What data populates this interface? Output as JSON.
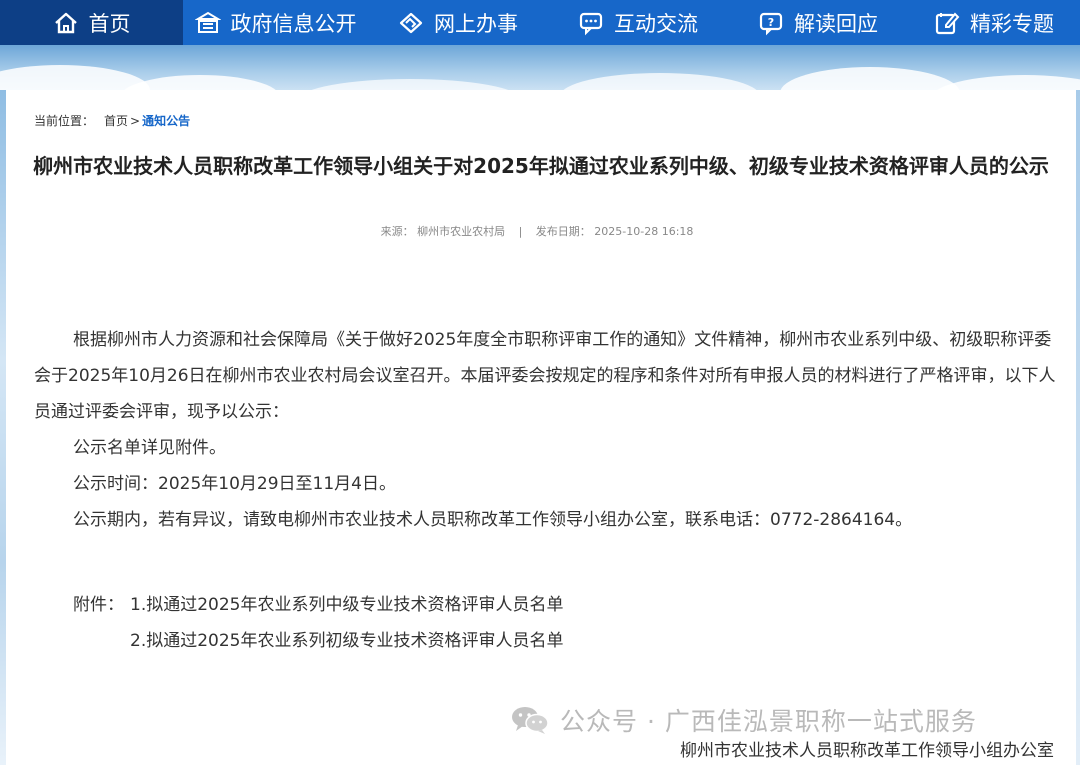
{
  "nav": {
    "items": [
      {
        "label": "首页",
        "icon": "home-icon"
      },
      {
        "label": "政府信息公开",
        "icon": "building-icon"
      },
      {
        "label": "网上办事",
        "icon": "handshake-icon"
      },
      {
        "label": "互动交流",
        "icon": "chat-icon"
      },
      {
        "label": "解读回应",
        "icon": "question-chat-icon"
      },
      {
        "label": "精彩专题",
        "icon": "edit-icon"
      }
    ]
  },
  "breadcrumb": {
    "prefix": "当前位置：",
    "home": "首页",
    "separator": ">",
    "current": "通知公告"
  },
  "article": {
    "title": "柳州市农业技术人员职称改革工作领导小组关于对2025年拟通过农业系列中级、初级专业技术资格评审人员的公示",
    "source_label": "来源：",
    "source": "柳州市农业农村局",
    "divider": "|",
    "date_label": "发布日期：",
    "date": "2025-10-28 16:18",
    "paragraphs": [
      "根据柳州市人力资源和社会保障局《关于做好2025年度全市职称评审工作的通知》文件精神，柳州市农业系列中级、初级职称评委会于2025年10月26日在柳州市农业农村局会议室召开。本届评委会按规定的程序和条件对所有申报人员的材料进行了严格评审，以下人员通过评委会评审，现予以公示：",
      "公示名单详见附件。",
      "公示时间：2025年10月29日至11月4日。",
      "公示期内，若有异议，请致电柳州市农业技术人员职称改革工作领导小组办公室，联系电话：0772-2864164。"
    ],
    "attachment_label": "附件：",
    "attachments": [
      "1.拟通过2025年农业系列中级专业技术资格评审人员名单",
      "2.拟通过2025年农业系列初级专业技术资格评审人员名单"
    ],
    "signature": "柳州市农业技术人员职称改革工作领导小组办公室"
  },
  "watermark": {
    "icon": "wechat-icon",
    "text": "公众号 · 广西佳泓景职称一站式服务"
  },
  "colors": {
    "nav_bg": "#1767c9",
    "nav_active": "#0d3f86",
    "link": "#1767c9"
  }
}
